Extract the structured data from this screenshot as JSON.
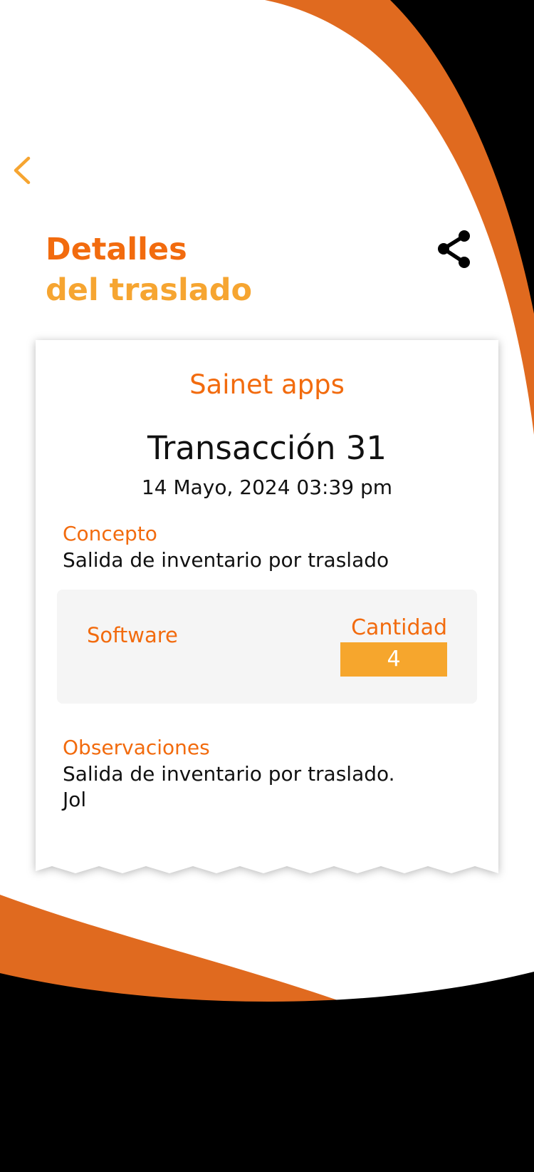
{
  "header": {
    "title_line1": "Detalles",
    "title_line2": "del traslado"
  },
  "icons": {
    "back": "chevron-left-icon",
    "share": "share-icon"
  },
  "receipt": {
    "company": "Sainet apps",
    "transaction": "Transacción 31",
    "date": "14 Mayo, 2024 03:39 pm",
    "concept_label": "Concepto",
    "concept_value": "Salida de inventario por traslado",
    "item": {
      "name": "Software",
      "quantity_label": "Cantidad",
      "quantity": "4"
    },
    "observations_label": "Observaciones",
    "observations_line1": "Salida de inventario por traslado.",
    "observations_line2": "Jol"
  },
  "colors": {
    "orange_dark": "#f26b0e",
    "orange_light": "#f6a531",
    "orange_band": "#e06a1f",
    "black": "#000000"
  }
}
